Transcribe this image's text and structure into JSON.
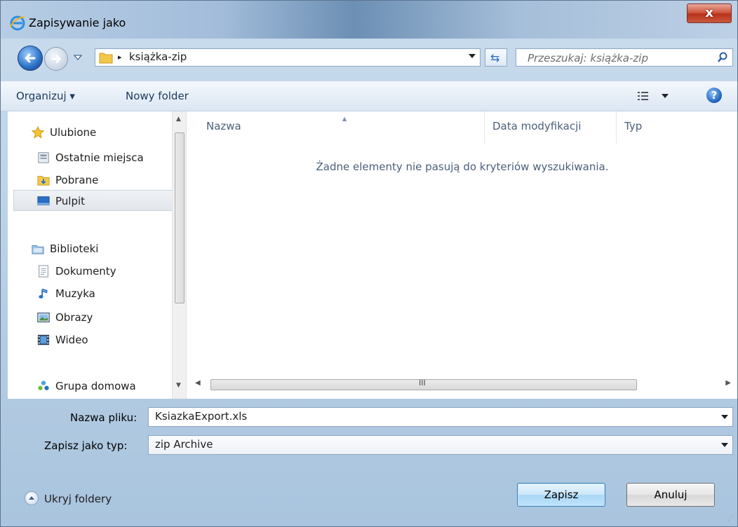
{
  "window": {
    "title": "Zapisywanie jako",
    "close_label": "x"
  },
  "nav": {
    "path_separator": "▸",
    "current_folder": "książka-zip",
    "search_placeholder": "Przeszukaj: książka-zip"
  },
  "toolbar": {
    "organize_label": "Organizuj ▾",
    "new_folder_label": "Nowy folder",
    "help_label": "?"
  },
  "sidebar": {
    "items": [
      {
        "label": "Ulubione",
        "icon": "star-icon"
      },
      {
        "label": "Ostatnie miejsca",
        "icon": "recent-places-icon"
      },
      {
        "label": "Pobrane",
        "icon": "downloads-folder-icon"
      },
      {
        "label": "Pulpit",
        "icon": "desktop-icon"
      },
      {
        "label": "Biblioteki",
        "icon": "libraries-icon"
      },
      {
        "label": "Dokumenty",
        "icon": "documents-icon"
      },
      {
        "label": "Muzyka",
        "icon": "music-icon"
      },
      {
        "label": "Obrazy",
        "icon": "pictures-icon"
      },
      {
        "label": "Wideo",
        "icon": "video-icon"
      },
      {
        "label": "Grupa domowa",
        "icon": "homegroup-icon"
      }
    ],
    "selected": "Pulpit"
  },
  "filelist": {
    "columns": [
      "Nazwa",
      "Data modyfikacji",
      "Typ"
    ],
    "empty_message": "Żadne elementy nie pasują do kryteriów wyszukiwania.",
    "scroll_grip": "III"
  },
  "form": {
    "filename_label": "Nazwa pliku:",
    "filename_value": "KsiazkaExport.xls",
    "type_label": "Zapisz jako typ:",
    "type_value": "zip Archive"
  },
  "footer": {
    "hide_folders_label": "Ukryj foldery",
    "save_label": "Zapisz",
    "cancel_label": "Anuluj"
  },
  "colors": {
    "window_frame": "#a9c4de",
    "accent_blue": "#2a6fc7",
    "text_blue": "#1e395b",
    "close_red": "#c95a3f"
  }
}
